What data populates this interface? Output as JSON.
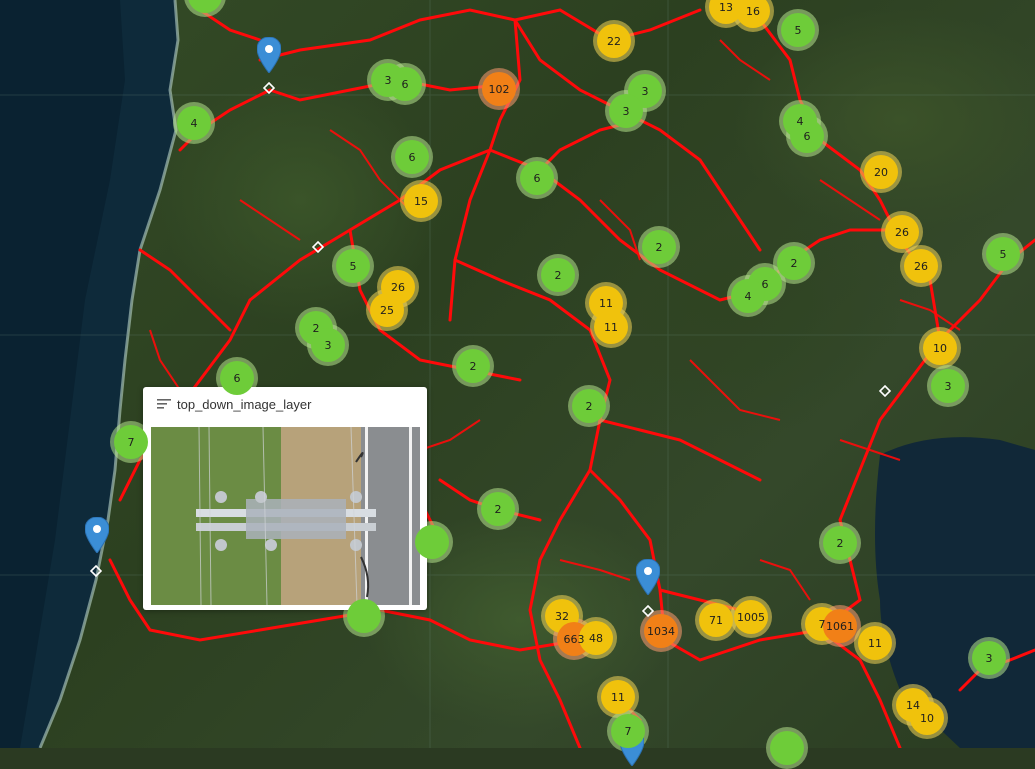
{
  "map": {
    "clusters": [
      {
        "label": "",
        "color": "green"
      },
      {
        "label": "13",
        "color": "yellow"
      },
      {
        "label": "16",
        "color": "yellow"
      },
      {
        "label": "5",
        "color": "green"
      },
      {
        "label": "22",
        "color": "yellow"
      },
      {
        "label": "3",
        "color": "green"
      },
      {
        "label": "6",
        "color": "green"
      },
      {
        "label": "102",
        "color": "orange"
      },
      {
        "label": "3",
        "color": "green"
      },
      {
        "label": "3",
        "color": "green"
      },
      {
        "label": "4",
        "color": "green"
      },
      {
        "label": "4",
        "color": "green"
      },
      {
        "label": "6",
        "color": "green"
      },
      {
        "label": "6",
        "color": "green"
      },
      {
        "label": "6",
        "color": "green"
      },
      {
        "label": "20",
        "color": "yellow"
      },
      {
        "label": "15",
        "color": "yellow"
      },
      {
        "label": "26",
        "color": "yellow"
      },
      {
        "label": "2",
        "color": "green"
      },
      {
        "label": "5",
        "color": "green"
      },
      {
        "label": "2",
        "color": "green"
      },
      {
        "label": "2",
        "color": "green"
      },
      {
        "label": "26",
        "color": "yellow"
      },
      {
        "label": "5",
        "color": "green"
      },
      {
        "label": "26",
        "color": "yellow"
      },
      {
        "label": "6",
        "color": "green"
      },
      {
        "label": "4",
        "color": "green"
      },
      {
        "label": "11",
        "color": "yellow"
      },
      {
        "label": "25",
        "color": "yellow"
      },
      {
        "label": "11",
        "color": "yellow"
      },
      {
        "label": "2",
        "color": "green"
      },
      {
        "label": "3",
        "color": "green"
      },
      {
        "label": "10",
        "color": "yellow"
      },
      {
        "label": "6",
        "color": "green"
      },
      {
        "label": "2",
        "color": "green"
      },
      {
        "label": "3",
        "color": "green"
      },
      {
        "label": "2",
        "color": "green"
      },
      {
        "label": "7",
        "color": "green"
      },
      {
        "label": "2",
        "color": "green"
      },
      {
        "label": "",
        "color": "green"
      },
      {
        "label": "2",
        "color": "green"
      },
      {
        "label": "",
        "color": "green"
      },
      {
        "label": "32",
        "color": "yellow"
      },
      {
        "label": "663",
        "color": "orange"
      },
      {
        "label": "48",
        "color": "yellow"
      },
      {
        "label": "1034",
        "color": "orange"
      },
      {
        "label": "71",
        "color": "yellow"
      },
      {
        "label": "1005",
        "color": "yellow"
      },
      {
        "label": "7",
        "color": "yellow"
      },
      {
        "label": "1061",
        "color": "orange"
      },
      {
        "label": "11",
        "color": "yellow"
      },
      {
        "label": "3",
        "color": "green"
      },
      {
        "label": "11",
        "color": "yellow"
      },
      {
        "label": "7",
        "color": "green"
      },
      {
        "label": "14",
        "color": "yellow"
      },
      {
        "label": "10",
        "color": "yellow"
      },
      {
        "label": "",
        "color": "green"
      }
    ],
    "marker_color": "#3b8ed6",
    "line_color": "#ff0000"
  },
  "popup": {
    "title": "top_down_image_layer",
    "icon": "layer-list-icon",
    "image": "top-down-image"
  }
}
